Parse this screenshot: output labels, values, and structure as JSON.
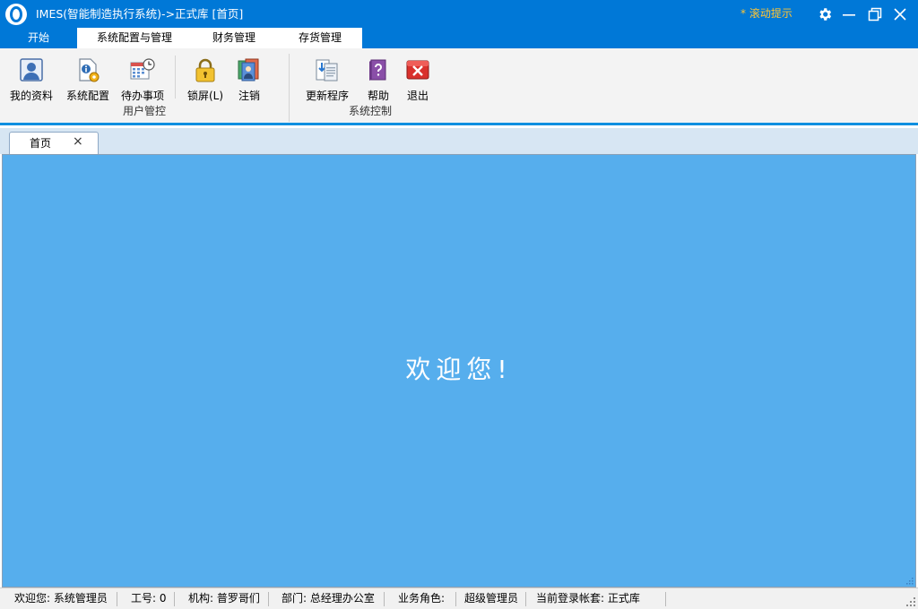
{
  "window": {
    "title": "IMES(智能制造执行系统)->正式库 [首页]",
    "scroll_hint": "* 滚动提示"
  },
  "ribbon": {
    "tabs": [
      {
        "label": "开始"
      },
      {
        "label": "系统配置与管理"
      },
      {
        "label": "财务管理"
      },
      {
        "label": "存货管理"
      }
    ],
    "groups": {
      "user_control": {
        "label": "用户管控",
        "buttons": [
          {
            "label": "我的资料",
            "icon": "user-profile-icon"
          },
          {
            "label": "系统配置",
            "icon": "system-config-icon"
          },
          {
            "label": "待办事项",
            "icon": "calendar-clock-icon"
          },
          {
            "label": "锁屏(L)",
            "icon": "lock-icon"
          },
          {
            "label": "注销",
            "icon": "logout-users-icon"
          }
        ]
      },
      "system_control": {
        "label": "系统控制",
        "buttons": [
          {
            "label": "更新程序",
            "icon": "update-icon"
          },
          {
            "label": "帮助",
            "icon": "help-book-icon"
          },
          {
            "label": "退出",
            "icon": "exit-icon"
          }
        ]
      }
    }
  },
  "doc_tabs": [
    {
      "label": "首页",
      "close": "×"
    }
  ],
  "main": {
    "welcome": "欢迎您!"
  },
  "status": {
    "welcome_user": "欢迎您: 系统管理员",
    "job_no": "工号: 0",
    "org": "机构: 普罗哥们",
    "dept": "部门: 总经理办公室",
    "role_label": "业务角色:",
    "role": "超级管理员",
    "account": "当前登录帐套: 正式库"
  },
  "colors": {
    "titlebar": "#0078d7",
    "main_background": "#56aeed",
    "scroll_hint": "#ffc533"
  }
}
